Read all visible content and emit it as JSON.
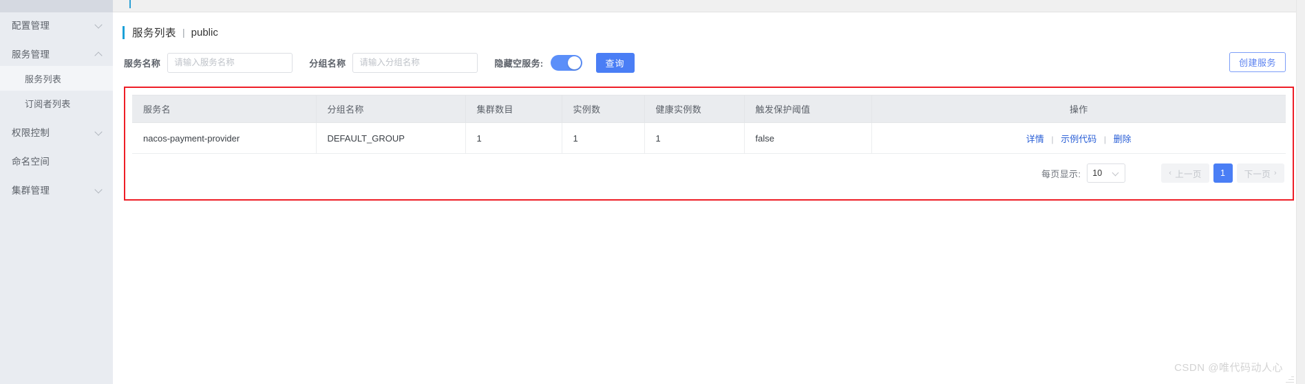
{
  "sidebar": {
    "items": [
      {
        "label": "配置管理",
        "icon": "chevron-down-icon",
        "expanded": false,
        "sub": false,
        "active": false
      },
      {
        "label": "服务管理",
        "icon": "chevron-up-icon",
        "expanded": true,
        "sub": false,
        "active": false
      },
      {
        "label": "服务列表",
        "icon": "",
        "expanded": false,
        "sub": true,
        "active": true
      },
      {
        "label": "订阅者列表",
        "icon": "",
        "expanded": false,
        "sub": true,
        "active": false
      },
      {
        "label": "权限控制",
        "icon": "chevron-down-icon",
        "expanded": false,
        "sub": false,
        "active": false
      },
      {
        "label": "命名空间",
        "icon": "",
        "expanded": false,
        "sub": false,
        "active": false
      },
      {
        "label": "集群管理",
        "icon": "chevron-down-icon",
        "expanded": false,
        "sub": false,
        "active": false
      }
    ]
  },
  "breadcrumb": {
    "title": "服务列表",
    "separator": "|",
    "namespace": "public",
    "accent_color": "#1ba0d8"
  },
  "filters": {
    "service_name_label": "服务名称",
    "service_name_value": "",
    "service_name_placeholder": "请输入服务名称",
    "group_name_label": "分组名称",
    "group_name_value": "",
    "group_name_placeholder": "请输入分组名称",
    "hide_empty_label": "隐藏空服务:",
    "hide_empty_on": true,
    "query_button": "查询",
    "create_button": "创建服务",
    "primary_color": "#4a7ef5",
    "switch_color": "#5b8ff9"
  },
  "table": {
    "highlight_border_color": "#ee1c25",
    "columns": [
      "服务名",
      "分组名称",
      "集群数目",
      "实例数",
      "健康实例数",
      "触发保护阈值",
      "操作"
    ],
    "rows": [
      {
        "service_name": "nacos-payment-provider",
        "group_name": "DEFAULT_GROUP",
        "cluster_count": "1",
        "instance_count": "1",
        "healthy_instance_count": "1",
        "protect_threshold": "false",
        "actions": [
          "详情",
          "示例代码",
          "删除"
        ],
        "action_separator": "|"
      }
    ]
  },
  "pagination": {
    "page_size_label": "每页显示:",
    "page_size_value": "10",
    "prev_label": "上一页",
    "next_label": "下一页",
    "prev_arrow": "‹",
    "next_arrow": "›",
    "current_page": "1"
  },
  "watermark": {
    "text": "CSDN @唯代码动人心"
  }
}
